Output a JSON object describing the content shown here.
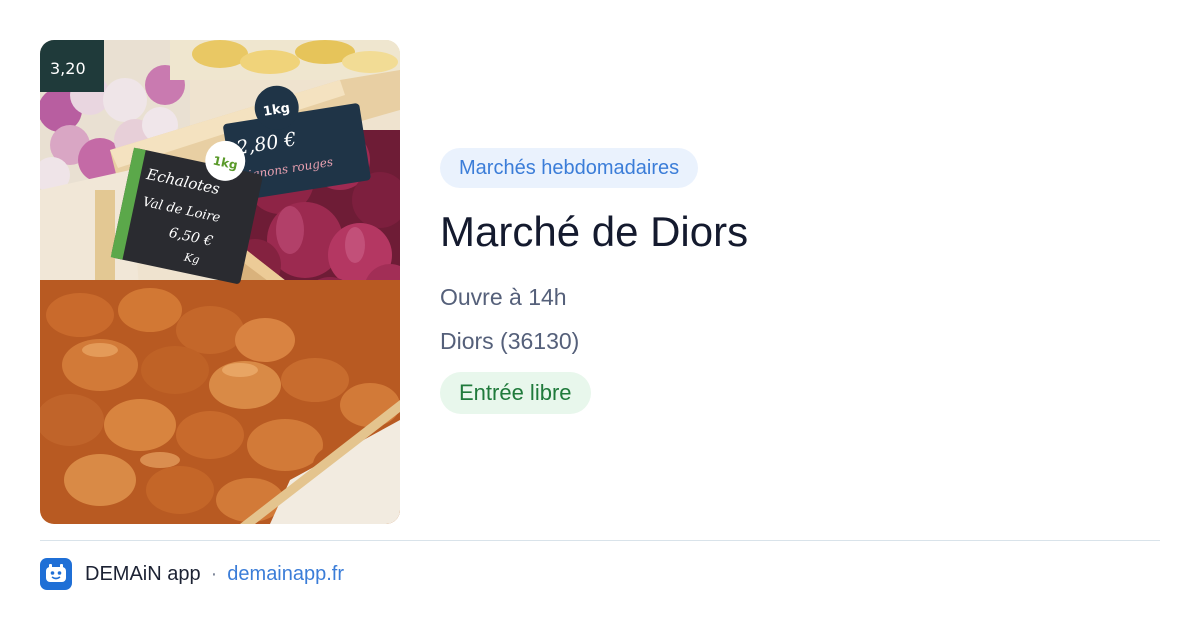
{
  "card": {
    "category_tag": "Marchés hebdomadaires",
    "title": "Marché de Diors",
    "hours": "Ouvre à 14h",
    "location": "Diors (36130)",
    "access_badge": "Entrée libre"
  },
  "photo": {
    "price_tag_left": {
      "weight": "1kg",
      "product": "Echalotes",
      "variety": "Val de Loire",
      "price": "6,50 €",
      "unit": "Kg"
    },
    "price_tag_right": {
      "weight": "1kg",
      "price": "2,80 €",
      "product": "oignons rouges"
    },
    "price_tag_top": {
      "price": "3,20"
    }
  },
  "footer": {
    "app_name": "DEMAiN app",
    "separator": "·",
    "domain": "demainapp.fr",
    "logo_icon": "demain-app-logo-icon"
  },
  "colors": {
    "category_bg": "#eaf2fd",
    "category_text": "#3b7dd8",
    "title": "#141a2e",
    "meta": "#55607a",
    "access_bg": "#e8f7ec",
    "access_text": "#1f7a3b",
    "link": "#3b7dd8"
  }
}
